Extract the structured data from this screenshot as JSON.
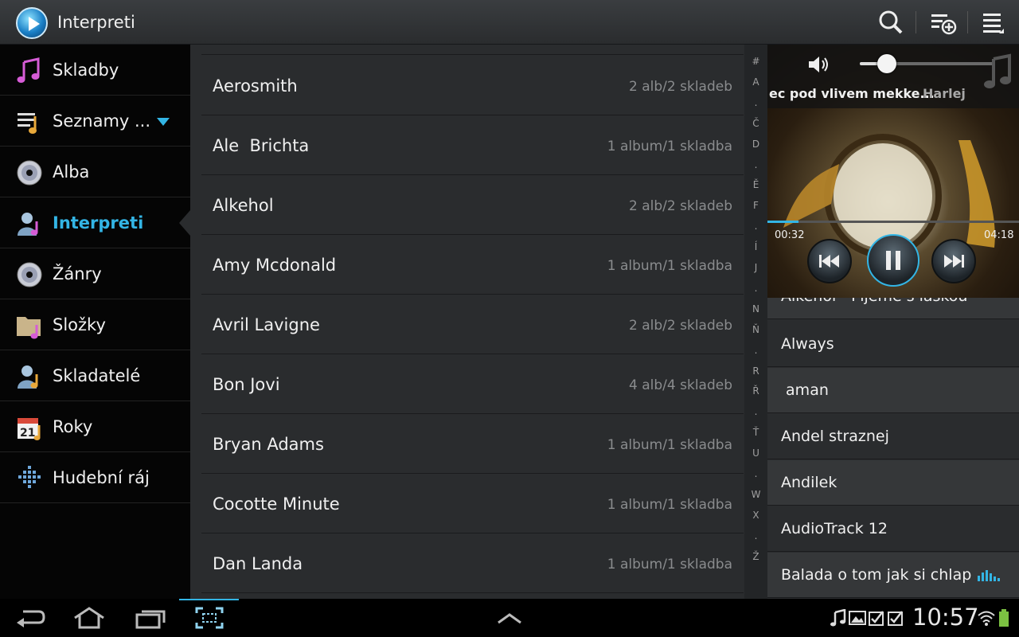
{
  "colors": {
    "accent": "#33b5e5",
    "list_bg": "#2a2c2e",
    "nav_bg": "#050505"
  },
  "actionbar": {
    "title": "Interpreti",
    "icons": [
      "app-logo-icon",
      "search-icon",
      "add-to-playlist-icon",
      "menu-list-icon"
    ]
  },
  "nav": {
    "items": [
      {
        "label": "Skladby",
        "icon": "music-note-icon"
      },
      {
        "label": "Seznamy ...",
        "icon": "playlist-icon"
      },
      {
        "label": "Alba",
        "icon": "cd-icon"
      },
      {
        "label": "Interpreti",
        "icon": "artist-icon",
        "active": true
      },
      {
        "label": "Žánry",
        "icon": "cd-icon"
      },
      {
        "label": "Složky",
        "icon": "folder-music-icon"
      },
      {
        "label": "Skladatelé",
        "icon": "composer-icon"
      },
      {
        "label": "Roky",
        "icon": "calendar-icon"
      },
      {
        "label": "Hudební ráj",
        "icon": "music-square-icon"
      }
    ]
  },
  "artists": [
    {
      "name": "Aerosmith",
      "count": "2 alb/2 skladeb"
    },
    {
      "name": "Ale  Brichta",
      "count": "1 album/1 skladba"
    },
    {
      "name": "Alkehol",
      "count": "2 alb/2 skladeb"
    },
    {
      "name": "Amy Mcdonald",
      "count": "1 album/1 skladba"
    },
    {
      "name": "Avril Lavigne",
      "count": "2 alb/2 skladeb"
    },
    {
      "name": "Bon Jovi",
      "count": "4 alb/4 skladeb"
    },
    {
      "name": "Bryan Adams",
      "count": "1 album/1 skladba"
    },
    {
      "name": "Cocotte Minute",
      "count": "1 album/1 skladba"
    },
    {
      "name": "Dan Landa",
      "count": "1 album/1 skladba"
    }
  ],
  "index_letters": [
    "#",
    "A",
    ".",
    "Č",
    "D",
    ".",
    "Ě",
    "F",
    ".",
    "Í",
    "J",
    ".",
    "N",
    "Ň",
    ".",
    "R",
    "Ř",
    ".",
    "Ť",
    "U",
    ".",
    "W",
    "X",
    ".",
    "Ž"
  ],
  "player": {
    "track_title": "ec pod vlivem mekke...",
    "track_artist": "Harlej",
    "elapsed": "00:32",
    "duration": "04:18",
    "progress": 0.124,
    "volume": 0.2
  },
  "queue": [
    {
      "label": "Alkehol - Pijeme s láskou"
    },
    {
      "label": "Always"
    },
    {
      "label": " aman"
    },
    {
      "label": "Andel straznej"
    },
    {
      "label": "Andilek"
    },
    {
      "label": "AudioTrack 12"
    },
    {
      "label": "Balada o tom jak si chlapec",
      "playing": true
    }
  ],
  "statusbar": {
    "time": "10:57",
    "nav_icons": [
      "back-icon",
      "home-icon",
      "recent-apps-icon",
      "screenshot-icon",
      "up-arrow-icon"
    ],
    "notification_icons": [
      "music-notification-icon",
      "gallery-notification-icon",
      "checkbox-notification-icon",
      "checkbox-notification-icon",
      "wifi-icon",
      "battery-icon"
    ]
  }
}
